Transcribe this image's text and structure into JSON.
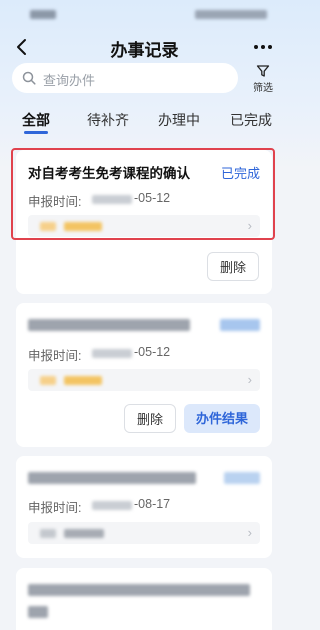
{
  "header": {
    "title": "办事记录",
    "back_icon": "chevron-left-icon",
    "more_icon": "more-dots-icon"
  },
  "search": {
    "placeholder": "查询办件",
    "filter_label": "筛选",
    "filter_icon": "filter-funnel-icon"
  },
  "tabs": [
    {
      "label": "全部",
      "active": true
    },
    {
      "label": "待补齐",
      "active": false
    },
    {
      "label": "办理中",
      "active": false
    },
    {
      "label": "已完成",
      "active": false
    }
  ],
  "records": [
    {
      "title": "对自考考生免考课程的确认",
      "status": "已完成",
      "date_label": "申报时间:",
      "date_suffix": "-05-12",
      "delete_label": "删除"
    },
    {
      "date_label": "申报时间:",
      "date_suffix": "-05-12",
      "delete_label": "删除",
      "result_label": "办件结果"
    },
    {
      "date_label": "申报时间:",
      "date_suffix": "-08-17"
    }
  ],
  "colors": {
    "accent": "#2f66d9",
    "highlight": "#e0424d",
    "background": "#f2f4f8"
  }
}
